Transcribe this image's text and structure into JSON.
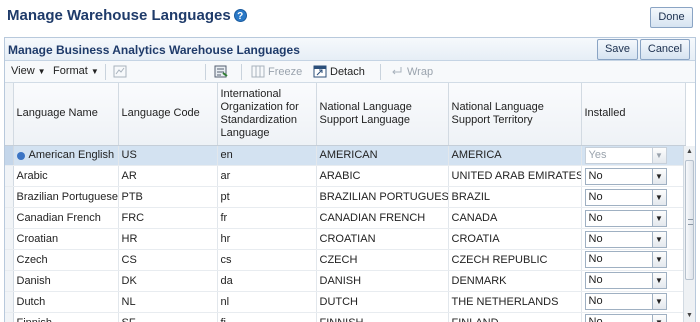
{
  "page": {
    "title": "Manage Warehouse Languages",
    "done_label": "Done"
  },
  "panel": {
    "title": "Manage Business Analytics Warehouse Languages",
    "save_label": "Save",
    "cancel_label": "Cancel"
  },
  "toolbar": {
    "view_label": "View",
    "format_label": "Format",
    "freeze_label": "Freeze",
    "detach_label": "Detach",
    "wrap_label": "Wrap"
  },
  "columns": [
    "Language Name",
    "Language Code",
    "International Organization for Standardization Language",
    "National Language Support Language",
    "National Language Support Territory",
    "Installed"
  ],
  "rows": [
    {
      "name": "American English",
      "code": "US",
      "iso": "en",
      "nls_lang": "AMERICAN",
      "nls_terr": "AMERICA",
      "installed": "Yes",
      "selected": true
    },
    {
      "name": "Arabic",
      "code": "AR",
      "iso": "ar",
      "nls_lang": "ARABIC",
      "nls_terr": "UNITED ARAB EMIRATES",
      "installed": "No"
    },
    {
      "name": "Brazilian Portuguese",
      "code": "PTB",
      "iso": "pt",
      "nls_lang": "BRAZILIAN PORTUGUESE",
      "nls_terr": "BRAZIL",
      "installed": "No"
    },
    {
      "name": "Canadian French",
      "code": "FRC",
      "iso": "fr",
      "nls_lang": "CANADIAN FRENCH",
      "nls_terr": "CANADA",
      "installed": "No"
    },
    {
      "name": "Croatian",
      "code": "HR",
      "iso": "hr",
      "nls_lang": "CROATIAN",
      "nls_terr": "CROATIA",
      "installed": "No"
    },
    {
      "name": "Czech",
      "code": "CS",
      "iso": "cs",
      "nls_lang": "CZECH",
      "nls_terr": "CZECH REPUBLIC",
      "installed": "No"
    },
    {
      "name": "Danish",
      "code": "DK",
      "iso": "da",
      "nls_lang": "DANISH",
      "nls_terr": "DENMARK",
      "installed": "No"
    },
    {
      "name": "Dutch",
      "code": "NL",
      "iso": "nl",
      "nls_lang": "DUTCH",
      "nls_terr": "THE NETHERLANDS",
      "installed": "No"
    },
    {
      "name": "Finnish",
      "code": "SF",
      "iso": "fi",
      "nls_lang": "FINNISH",
      "nls_terr": "FINLAND",
      "installed": "No"
    }
  ]
}
